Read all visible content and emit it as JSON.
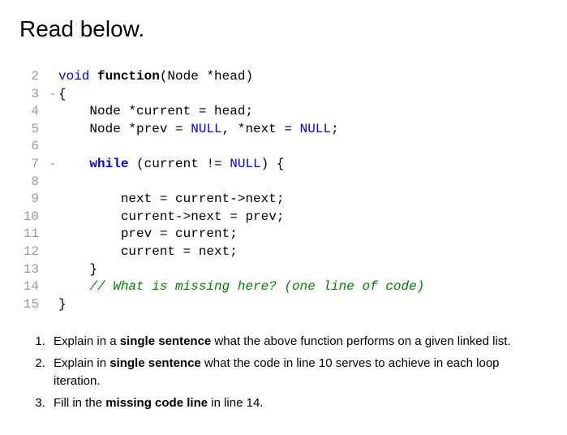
{
  "heading": "Read below.",
  "code": {
    "lines": [
      {
        "num": "2",
        "marker": "",
        "indent": "",
        "segments": [
          {
            "text": "void",
            "class": "kw-void"
          },
          {
            "text": " ",
            "class": ""
          },
          {
            "text": "function",
            "class": "kw-func"
          },
          {
            "text": "(Node *head)",
            "class": ""
          }
        ]
      },
      {
        "num": "3",
        "marker": "-",
        "indent": "",
        "segments": [
          {
            "text": "{",
            "class": ""
          }
        ]
      },
      {
        "num": "4",
        "marker": "",
        "indent": "    ",
        "segments": [
          {
            "text": "Node *current = head;",
            "class": ""
          }
        ]
      },
      {
        "num": "5",
        "marker": "",
        "indent": "    ",
        "segments": [
          {
            "text": "Node *prev = ",
            "class": ""
          },
          {
            "text": "NULL",
            "class": "kw-null"
          },
          {
            "text": ", *next = ",
            "class": ""
          },
          {
            "text": "NULL",
            "class": "kw-null"
          },
          {
            "text": ";",
            "class": ""
          }
        ]
      },
      {
        "num": "6",
        "marker": "",
        "indent": "",
        "segments": []
      },
      {
        "num": "7",
        "marker": "-",
        "indent": "    ",
        "segments": [
          {
            "text": "while",
            "class": "kw-while"
          },
          {
            "text": " (current != ",
            "class": ""
          },
          {
            "text": "NULL",
            "class": "kw-null"
          },
          {
            "text": ") {",
            "class": ""
          }
        ]
      },
      {
        "num": "8",
        "marker": "",
        "indent": "",
        "segments": []
      },
      {
        "num": "9",
        "marker": "",
        "indent": "        ",
        "segments": [
          {
            "text": "next = current->next;",
            "class": ""
          }
        ]
      },
      {
        "num": "10",
        "marker": "",
        "indent": "        ",
        "segments": [
          {
            "text": "current->next = prev;",
            "class": ""
          }
        ]
      },
      {
        "num": "11",
        "marker": "",
        "indent": "        ",
        "segments": [
          {
            "text": "prev = current;",
            "class": ""
          }
        ]
      },
      {
        "num": "12",
        "marker": "",
        "indent": "        ",
        "segments": [
          {
            "text": "current = next;",
            "class": ""
          }
        ]
      },
      {
        "num": "13",
        "marker": "",
        "indent": "    ",
        "segments": [
          {
            "text": "}",
            "class": ""
          }
        ]
      },
      {
        "num": "14",
        "marker": "",
        "indent": "    ",
        "segments": [
          {
            "text": "// What is missing here? (one line of code)",
            "class": "comment"
          }
        ]
      },
      {
        "num": "15",
        "marker": "",
        "indent": "",
        "segments": [
          {
            "text": "}",
            "class": ""
          }
        ]
      }
    ]
  },
  "questions": [
    {
      "parts": [
        {
          "text": "Explain in a ",
          "bold": false
        },
        {
          "text": "single sentence",
          "bold": true
        },
        {
          "text": " what the above function performs on a given linked list.",
          "bold": false
        }
      ]
    },
    {
      "parts": [
        {
          "text": "Explain in ",
          "bold": false
        },
        {
          "text": "single sentence",
          "bold": true
        },
        {
          "text": " what the code in line 10 serves to achieve in each loop iteration.",
          "bold": false
        }
      ]
    },
    {
      "parts": [
        {
          "text": "Fill in the ",
          "bold": false
        },
        {
          "text": "missing code line",
          "bold": true
        },
        {
          "text": " in line 14.",
          "bold": false
        }
      ]
    }
  ]
}
